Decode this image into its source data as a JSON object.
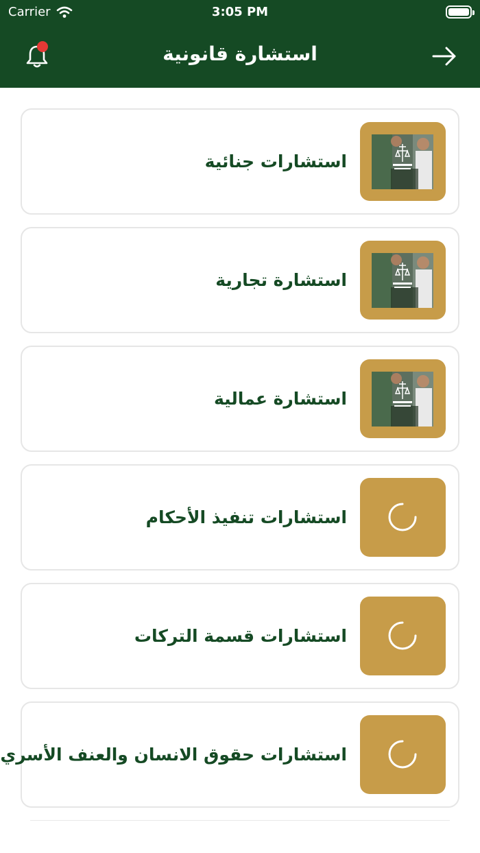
{
  "status_bar": {
    "carrier": "Carrier",
    "time": "3:05 PM"
  },
  "header": {
    "title": "استشارة قانونية"
  },
  "colors": {
    "header_bg": "#154a24",
    "accent_gold": "#c79c49",
    "notification": "#e53935"
  },
  "categories": [
    {
      "label": "استشارات جنائية",
      "thumb": "photo"
    },
    {
      "label": "استشارة تجارية",
      "thumb": "photo"
    },
    {
      "label": "استشارة عمالية",
      "thumb": "photo"
    },
    {
      "label": "استشارات تنفيذ الأحكام",
      "thumb": "loading"
    },
    {
      "label": "استشارات قسمة التركات",
      "thumb": "loading"
    },
    {
      "label": "استشارات حقوق الانسان والعنف الأسري",
      "thumb": "loading"
    }
  ]
}
